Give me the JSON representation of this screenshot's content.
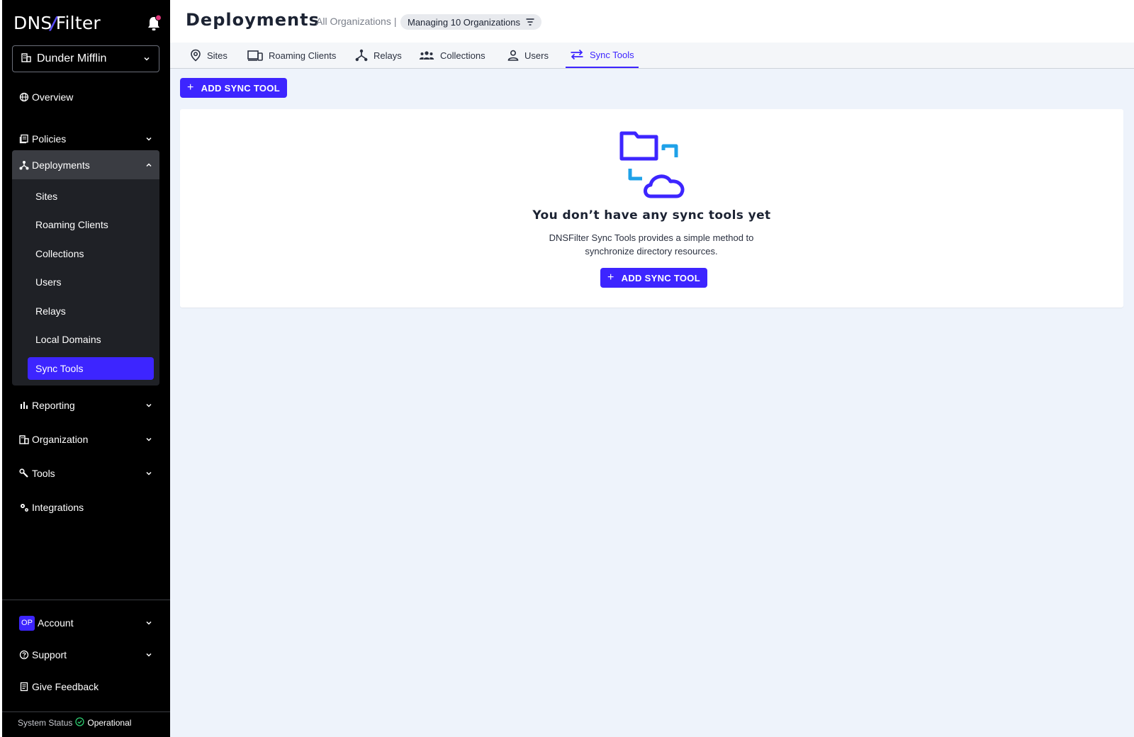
{
  "brand": {
    "logo_left": "DNS",
    "logo_slash": "/",
    "logo_right": "Filter",
    "accent": "#3d25ff"
  },
  "sidebar": {
    "org_selector": "Dunder Mifflin",
    "items": {
      "overview": "Overview",
      "policies": "Policies",
      "deployments": "Deployments",
      "reporting": "Reporting",
      "organization": "Organization",
      "tools": "Tools",
      "integrations": "Integrations"
    },
    "deployments_sub": [
      "Sites",
      "Roaming Clients",
      "Collections",
      "Users",
      "Relays",
      "Local Domains",
      "Sync Tools"
    ],
    "footer": {
      "account_avatar": "OP",
      "account": "Account",
      "support": "Support",
      "feedback": "Give Feedback",
      "status_label": "System Status",
      "status_value": "Operational"
    }
  },
  "header": {
    "title": "Deployments",
    "scope": "All Organizations",
    "separator": "|",
    "managing": "Managing 10 Organizations"
  },
  "tabs": [
    "Sites",
    "Roaming Clients",
    "Relays",
    "Collections",
    "Users",
    "Sync Tools"
  ],
  "active_tab": "Sync Tools",
  "actions": {
    "add_sync_tool": "ADD SYNC TOOL"
  },
  "empty_state": {
    "title": "You don’t have any sync tools yet",
    "description": "DNSFilter Sync Tools provides a simple method to synchronize directory resources.",
    "button": "ADD SYNC TOOL"
  }
}
